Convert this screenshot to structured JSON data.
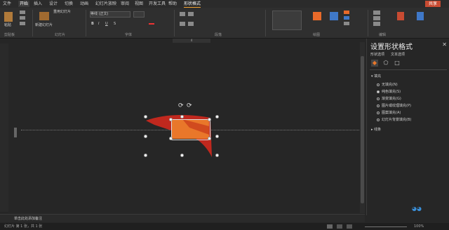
{
  "tabs": [
    "文件",
    "开始",
    "插入",
    "设计",
    "切换",
    "动画",
    "幻灯片放映",
    "审阅",
    "视图",
    "开发工具",
    "帮助",
    "形状格式"
  ],
  "share_label": "共享",
  "ribbon": {
    "paste": "粘贴",
    "new_slide": "新建幻灯片",
    "reuse": "重用幻灯片",
    "font_name": "等线 (正文)",
    "groups": [
      "剪贴板",
      "幻灯片",
      "字体",
      "段落",
      "绘图",
      "编辑"
    ]
  },
  "ruler_label": "4",
  "format_pane": {
    "title": "设置形状格式",
    "tab_shape": "形状选项",
    "tab_text": "文本选项",
    "fill_section": "填充",
    "fill_options": [
      "无填充(N)",
      "纯色填充(S)",
      "渐变填充(G)",
      "图片或纹理填充(P)",
      "图案填充(A)",
      "幻灯片背景填充(B)"
    ],
    "fill_selected_index": 1,
    "line_section": "线条"
  },
  "notes_placeholder": "单击此处添加备注",
  "status": {
    "left": "幻灯片 第 1 张，共 1 张",
    "zoom": "100%"
  },
  "colors": {
    "shape_orange": "#e9772a",
    "shape_red": "#c0281e",
    "accent": "#c84b32"
  }
}
